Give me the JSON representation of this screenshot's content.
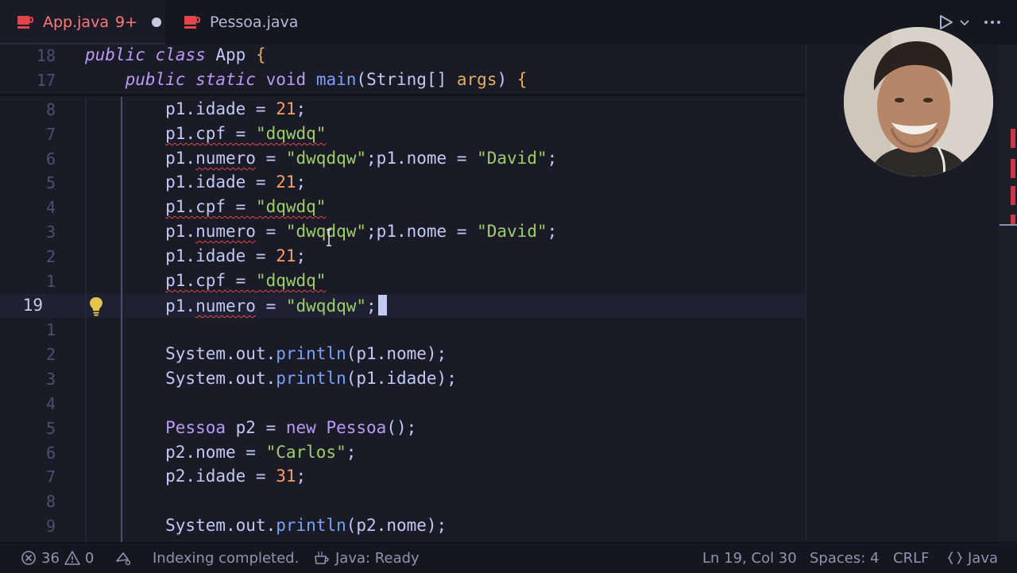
{
  "tabs": [
    {
      "label": "App.java",
      "badge": "9+",
      "modified": true,
      "active": true
    },
    {
      "label": "Pessoa.java",
      "active": false
    }
  ],
  "sticky": [
    {
      "num": "18",
      "code": "public class App {"
    },
    {
      "num": "17",
      "code": "    public static void main(String[] args) {"
    }
  ],
  "lines": [
    {
      "num": "8",
      "code": "        p1.idade = 21;"
    },
    {
      "num": "7",
      "code": "        p1.cpf = \"dqwdq\""
    },
    {
      "num": "6",
      "code": "        p1.numero = \"dwqdqw\";p1.nome = \"David\";"
    },
    {
      "num": "5",
      "code": "        p1.idade = 21;"
    },
    {
      "num": "4",
      "code": "        p1.cpf = \"dqwdq\""
    },
    {
      "num": "3",
      "code": "        p1.numero = \"dwqdqw\";p1.nome = \"David\";"
    },
    {
      "num": "2",
      "code": "        p1.idade = 21;"
    },
    {
      "num": "1",
      "code": "        p1.cpf = \"dqwdq\""
    },
    {
      "num": "19",
      "code": "        p1.numero = \"dwqdqw\";",
      "current": true
    },
    {
      "num": "1",
      "code": ""
    },
    {
      "num": "2",
      "code": "        System.out.println(p1.nome);"
    },
    {
      "num": "3",
      "code": "        System.out.println(p1.idade);"
    },
    {
      "num": "4",
      "code": ""
    },
    {
      "num": "5",
      "code": "        Pessoa p2 = new Pessoa();"
    },
    {
      "num": "6",
      "code": "        p2.nome = \"Carlos\";"
    },
    {
      "num": "7",
      "code": "        p2.idade = 31;"
    },
    {
      "num": "8",
      "code": ""
    },
    {
      "num": "9",
      "code": "        System.out.println(p2.nome);"
    }
  ],
  "status": {
    "errors": "36",
    "warnings": "0",
    "indexing": "Indexing completed.",
    "java_status": "Java: Ready",
    "position": "Ln 19, Col 30",
    "spaces": "Spaces: 4",
    "eol": "CRLF",
    "language": "Java"
  },
  "colors": {
    "background": "#1a1b26",
    "keyword": "#bb9af7",
    "string": "#9ece6a",
    "number": "#ff9e64",
    "function": "#7aa2f7",
    "error": "#e0464b"
  },
  "icons": {
    "run": "play-icon",
    "more": "more-icon",
    "java_file": "java-file-icon",
    "lightbulb": "lightbulb-icon"
  }
}
